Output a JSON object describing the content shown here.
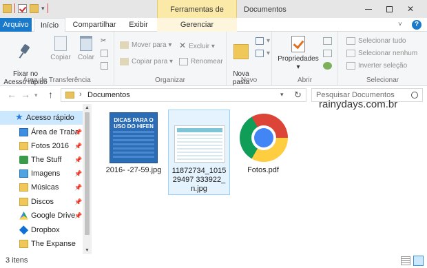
{
  "titlebar": {
    "context_tab": "Ferramentas de Imagem",
    "title": "Documentos"
  },
  "tabs": {
    "file": "Arquivo",
    "home": "Início",
    "share": "Compartilhar",
    "view": "Exibir",
    "manage": "Gerenciar",
    "help": "?"
  },
  "ribbon": {
    "clipboard": {
      "pin": "Fixar no\nAcesso rápido",
      "copy": "Copiar",
      "paste": "Colar",
      "label": "Área de Transferência"
    },
    "organize": {
      "move_to": "Mover para",
      "copy_to": "Copiar para",
      "delete": "Excluir",
      "rename": "Renomear",
      "label": "Organizar"
    },
    "new": {
      "new_folder": "Nova\npasta",
      "label": "Novo"
    },
    "open": {
      "properties": "Propriedades",
      "label": "Abrir"
    },
    "select": {
      "select_all": "Selecionar tudo",
      "select_none": "Selecionar nenhum",
      "invert": "Inverter seleção",
      "label": "Selecionar"
    }
  },
  "address": {
    "path": "Documentos",
    "search_placeholder": "Pesquisar Documentos"
  },
  "navpane": {
    "items": [
      {
        "label": "Acesso rápido",
        "icon": "star-icon"
      },
      {
        "label": "Área de Traba",
        "icon": "desktop-icon"
      },
      {
        "label": "Fotos 2016",
        "icon": "folder-icon"
      },
      {
        "label": "The Stuff",
        "icon": "stuff-icon"
      },
      {
        "label": "Imagens",
        "icon": "images-icon"
      },
      {
        "label": "Músicas",
        "icon": "folder-icon"
      },
      {
        "label": "Discos",
        "icon": "folder-icon"
      },
      {
        "label": "Google Drive",
        "icon": "google-drive-icon"
      },
      {
        "label": "Dropbox",
        "icon": "dropbox-icon"
      },
      {
        "label": "The Expanse",
        "icon": "folder-icon"
      }
    ]
  },
  "files": [
    {
      "name": "2016-           -27-59.jpg",
      "thumb_title": "DICAS PARA O USO DO HIFEN"
    },
    {
      "name": "11872734_101529497          333922_n.jpg"
    },
    {
      "name": "Fotos.pdf"
    }
  ],
  "watermark": "rainydays.com.br",
  "status": {
    "count": "3 itens"
  }
}
